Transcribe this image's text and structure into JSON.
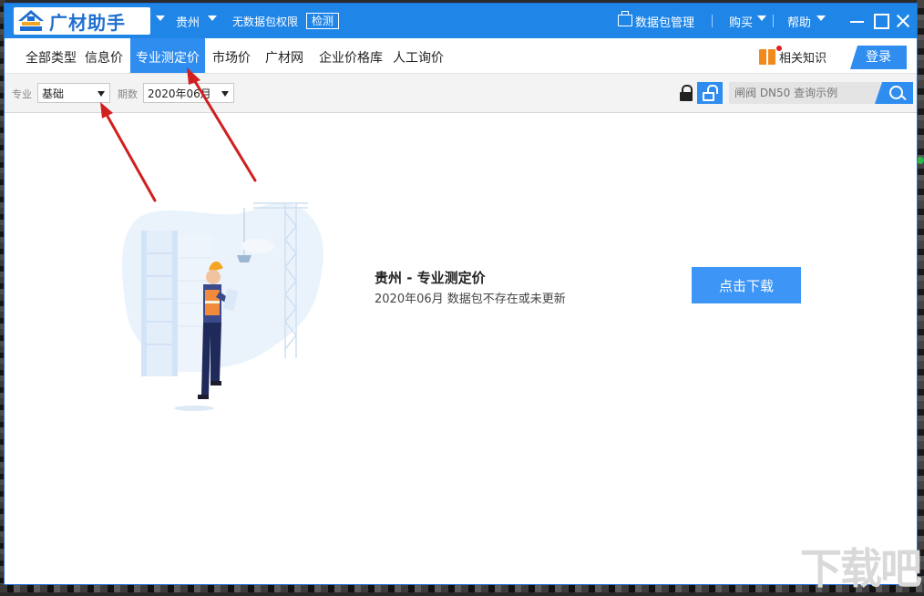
{
  "app": {
    "logo_text": "广材助手",
    "region": "贵州",
    "permission_text": "无数据包权限",
    "detect_label": "检测",
    "package_manage": "数据包管理",
    "buy": "购买",
    "help": "帮助"
  },
  "nav": {
    "tabs": [
      {
        "label": "全部类型"
      },
      {
        "label": "信息价"
      },
      {
        "label": "专业测定价"
      },
      {
        "label": "市场价"
      },
      {
        "label": "广材网"
      },
      {
        "label": "企业价格库"
      },
      {
        "label": "人工询价"
      }
    ],
    "active_tab": "专业测定价",
    "knowledge": "相关知识",
    "login": "登录"
  },
  "filters": {
    "major_label": "专业",
    "major_value": "基础",
    "period_label": "期数",
    "period_value": "2020年06月",
    "search_placeholder": "闸阀 DN50 查询示例"
  },
  "message": {
    "title": "贵州 - 专业测定价",
    "subtitle": "2020年06月 数据包不存在或未更新",
    "download": "点击下载"
  },
  "watermark": "下载吧",
  "colors": {
    "titlebar": "#1f86e8",
    "accent": "#2f8df0",
    "download_button": "#3d95f5",
    "annotation_arrow": "#d11f1f"
  },
  "icons": [
    "logo-icon",
    "caret-down-icon",
    "package-icon",
    "minimize-icon",
    "maximize-icon",
    "close-icon",
    "book-icon",
    "lock-icon",
    "unlock-icon",
    "search-icon"
  ]
}
